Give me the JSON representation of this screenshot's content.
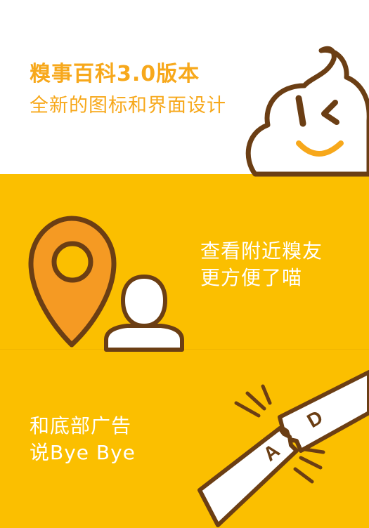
{
  "header": {
    "title": "糗事百科3.0版本",
    "subtitle": "全新的图标和界面设计"
  },
  "features": {
    "nearby": {
      "line1": "查看附近糗友",
      "line2": "更方便了喵"
    },
    "no_ads": {
      "line1": "和底部广告",
      "line2": "说Bye Bye"
    }
  },
  "icons": {
    "mascot": "poop-mascot-icon",
    "location": "location-pin-icon",
    "user": "user-icon",
    "ad_ribbon": "broken-ad-ribbon-icon"
  },
  "ad_ribbon": {
    "letter_a": "A",
    "letter_d": "D"
  },
  "colors": {
    "brand_orange": "#f7a81b",
    "background_yellow": "#fbbf00",
    "pin_orange": "#f59a23",
    "outline_brown": "#6b3e14",
    "white": "#ffffff"
  }
}
